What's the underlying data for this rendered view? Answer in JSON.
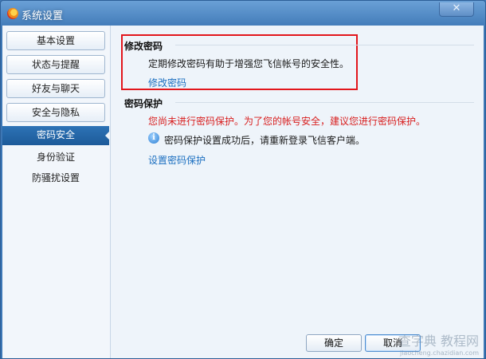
{
  "window": {
    "title": "系统设置",
    "close_glyph": "✕"
  },
  "sidebar": {
    "buttons": [
      {
        "label": "基本设置"
      },
      {
        "label": "状态与提醒"
      },
      {
        "label": "好友与聊天"
      },
      {
        "label": "安全与隐私"
      }
    ],
    "active": {
      "label": "密码安全"
    },
    "sub_items": [
      {
        "label": "身份验证"
      },
      {
        "label": "防骚扰设置"
      }
    ]
  },
  "change_password": {
    "title": "修改密码",
    "description": "定期修改密码有助于增强您飞信帐号的安全性。",
    "link": "修改密码"
  },
  "password_protection": {
    "title": "密码保护",
    "warning": "您尚未进行密码保护。为了您的帐号安全，建议您进行密码保护。",
    "info": "密码保护设置成功后，请重新登录飞信客户端。",
    "link": "设置密码保护"
  },
  "footer": {
    "ok_label": "确定",
    "cancel_label": "取消"
  },
  "watermark": {
    "text": "查字典 教程网",
    "sub": "jiaocheng.chazidian.com"
  },
  "colors": {
    "accent": "#1d5a99",
    "link": "#1c6fc0",
    "warning": "#d81e1e",
    "highlight": "#e2161c"
  }
}
